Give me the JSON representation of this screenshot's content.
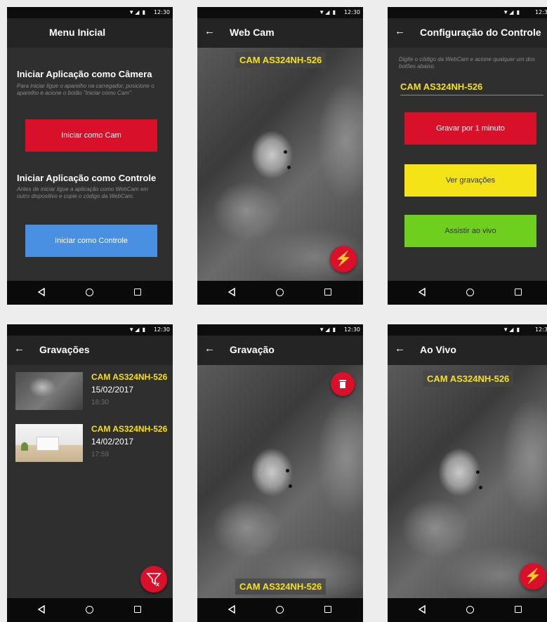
{
  "status_time": "12:30",
  "status_icons": "▼◢ ▮",
  "screens": {
    "menu": {
      "title": "Menu Inicial",
      "camera_section_title": "Iniciar Aplicação como Câmera",
      "camera_section_desc": "Para iniciar ligue o aparelho na carregador, posicione o aparelho e acione o botão \"Iniciar como Cam\".",
      "camera_button": "Iniciar como Cam",
      "control_section_title": "Iniciar Aplicação como Controle",
      "control_section_desc": "Antes de iniciar ligue a aplicação como WebCam em outro dispositivo e copie o código da WebCam.",
      "control_button": "Iniciar como Controle"
    },
    "webcam": {
      "title": "Web Cam",
      "cam_label": "CAM AS324NH-526",
      "fab_icon": "bolt-icon"
    },
    "config": {
      "title": "Configuração do Controle",
      "instructions": "Digite o código da WebCam e acione qualquer um dos botões abaixo.",
      "cam_code": "CAM AS324NH-526",
      "record_button": "Gravar por 1 minuto",
      "view_button": "Ver gravações",
      "live_button": "Assistir ao vivo"
    },
    "recordings": {
      "title": "Gravações",
      "items": [
        {
          "cam": "CAM AS324NH-526",
          "date": "15/02/2017",
          "time": "18:30"
        },
        {
          "cam": "CAM AS324NH-526",
          "date": "14/02/2017",
          "time": "17:59"
        }
      ],
      "fab_icon": "filter-clear-icon"
    },
    "recording": {
      "title": "Gravação",
      "cam_label": "CAM AS324NH-526",
      "fab_icon": "trash-icon"
    },
    "live": {
      "title": "Ao Vivo",
      "cam_label": "CAM AS324NH-526",
      "fab_icon": "bolt-icon"
    }
  },
  "colors": {
    "red": "#d8102a",
    "blue": "#4a90e2",
    "yellow": "#f4e317",
    "green": "#6fcf1f",
    "label_yellow": "#f7e011"
  }
}
